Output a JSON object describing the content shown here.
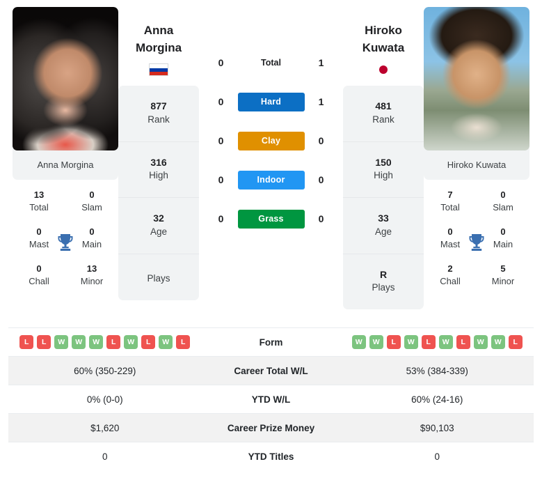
{
  "players": {
    "left": {
      "first_name": "Anna",
      "last_name": "Morgina",
      "full_name": "Anna Morgina",
      "country_flag": "flag-russia",
      "rank": "877",
      "rank_label": "Rank",
      "high": "316",
      "high_label": "High",
      "age": "32",
      "age_label": "Age",
      "plays": "",
      "plays_label": "Plays",
      "titles": {
        "total": "13",
        "total_label": "Total",
        "slam": "0",
        "slam_label": "Slam",
        "mast": "0",
        "mast_label": "Mast",
        "main": "0",
        "main_label": "Main",
        "chall": "0",
        "chall_label": "Chall",
        "minor": "13",
        "minor_label": "Minor"
      },
      "form": [
        "L",
        "L",
        "W",
        "W",
        "W",
        "L",
        "W",
        "L",
        "W",
        "L"
      ],
      "career_total_wl": "60% (350-229)",
      "ytd_wl": "0% (0-0)",
      "career_prize_money": "$1,620",
      "ytd_titles": "0"
    },
    "right": {
      "first_name": "Hiroko",
      "last_name": "Kuwata",
      "full_name": "Hiroko Kuwata",
      "country_flag": "flag-japan",
      "rank": "481",
      "rank_label": "Rank",
      "high": "150",
      "high_label": "High",
      "age": "33",
      "age_label": "Age",
      "plays": "R",
      "plays_label": "Plays",
      "titles": {
        "total": "7",
        "total_label": "Total",
        "slam": "0",
        "slam_label": "Slam",
        "mast": "0",
        "mast_label": "Mast",
        "main": "0",
        "main_label": "Main",
        "chall": "2",
        "chall_label": "Chall",
        "minor": "5",
        "minor_label": "Minor"
      },
      "form": [
        "W",
        "W",
        "L",
        "W",
        "L",
        "W",
        "L",
        "W",
        "W",
        "L"
      ],
      "career_total_wl": "53% (384-339)",
      "ytd_wl": "60% (24-16)",
      "career_prize_money": "$90,103",
      "ytd_titles": "0"
    }
  },
  "head_to_head": {
    "rows": [
      {
        "label": "Total",
        "left": "0",
        "right": "1",
        "style": "plain",
        "color": ""
      },
      {
        "label": "Hard",
        "left": "0",
        "right": "1",
        "style": "badge",
        "color": "#0c6fc4"
      },
      {
        "label": "Clay",
        "left": "0",
        "right": "0",
        "style": "badge",
        "color": "#e09000"
      },
      {
        "label": "Indoor",
        "left": "0",
        "right": "0",
        "style": "badge",
        "color": "#2196f3"
      },
      {
        "label": "Grass",
        "left": "0",
        "right": "0",
        "style": "badge",
        "color": "#009640"
      }
    ]
  },
  "stats_table": {
    "rows": [
      {
        "label": "Form",
        "type": "form",
        "shaded": false
      },
      {
        "label": "Career Total W/L",
        "type": "text",
        "key": "career_total_wl",
        "shaded": true
      },
      {
        "label": "YTD W/L",
        "type": "text",
        "key": "ytd_wl",
        "shaded": false
      },
      {
        "label": "Career Prize Money",
        "type": "text",
        "key": "career_prize_money",
        "shaded": true
      },
      {
        "label": "YTD Titles",
        "type": "text",
        "key": "ytd_titles",
        "shaded": false
      }
    ]
  },
  "colors": {
    "win": "#7cc47f",
    "loss": "#ef5350",
    "card_bg": "#f1f3f4",
    "row_shade": "#f2f2f2",
    "trophy": "#3a6fb0"
  }
}
